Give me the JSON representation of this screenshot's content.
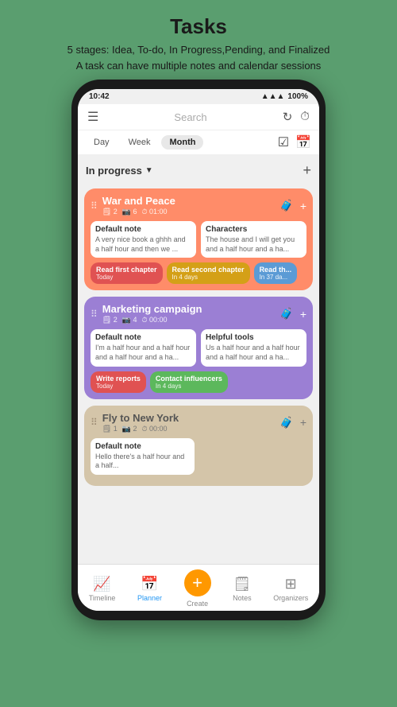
{
  "header": {
    "title": "Tasks",
    "subtitle1": "5 stages: Idea, To-do, In Progress,Pending, and Finalized",
    "subtitle2": "A task can have multiple notes and calendar sessions"
  },
  "statusBar": {
    "time": "10:42",
    "battery": "100%"
  },
  "topBar": {
    "searchPlaceholder": "Search"
  },
  "filterBar": {
    "tabs": [
      "Day",
      "Week",
      "Month"
    ],
    "activeTab": "Month"
  },
  "sectionHeader": {
    "title": "In progress",
    "addLabel": "+"
  },
  "tasks": [
    {
      "id": "war-and-peace",
      "title": "War and Peace",
      "meta": [
        "🗒 2",
        "📷 6",
        "⏱ 01:00"
      ],
      "colorClass": "orange",
      "notes": [
        {
          "title": "Default note",
          "body": "A very nice book a ghhh and a half hour and then we ..."
        },
        {
          "title": "Characters",
          "body": "The house and I will get you and a half hour and a ha..."
        }
      ],
      "sessions": [
        {
          "label": "Read first chapter",
          "sub": "Today",
          "chipClass": "chip-red"
        },
        {
          "label": "Read second chapter",
          "sub": "In 4 days",
          "chipClass": "chip-yellow"
        },
        {
          "label": "Read th...",
          "sub": "In 37 da...",
          "chipClass": "chip-blue"
        }
      ]
    },
    {
      "id": "marketing-campaign",
      "title": "Marketing campaign",
      "meta": [
        "🗒 2",
        "📷 4",
        "⏱ 00:00"
      ],
      "colorClass": "purple",
      "notes": [
        {
          "title": "Default note",
          "body": "I'm a half hour and a half hour and a half hour and a ha..."
        },
        {
          "title": "Helpful tools",
          "body": "Us a half hour and a half hour and a half hour and a ha..."
        }
      ],
      "sessions": [
        {
          "label": "Write reports",
          "sub": "Today",
          "chipClass": "chip-red"
        },
        {
          "label": "Contact influencers",
          "sub": "In 4 days",
          "chipClass": "chip-green"
        }
      ]
    },
    {
      "id": "fly-to-new-york",
      "title": "Fly to New York",
      "meta": [
        "🗒 1",
        "📷 2",
        "⏱ 00:00"
      ],
      "colorClass": "beige",
      "notes": [
        {
          "title": "Default note",
          "body": "Hello there's a half hour and a half..."
        }
      ],
      "sessions": []
    }
  ],
  "bottomNav": {
    "items": [
      {
        "id": "timeline",
        "label": "Timeline",
        "icon": "📈"
      },
      {
        "id": "planner",
        "label": "Planner",
        "icon": "📅",
        "active": true
      },
      {
        "id": "create",
        "label": "Create",
        "icon": "+"
      },
      {
        "id": "notes",
        "label": "Notes",
        "icon": "🗒"
      },
      {
        "id": "organizers",
        "label": "Organizers",
        "icon": "⊞"
      }
    ]
  }
}
